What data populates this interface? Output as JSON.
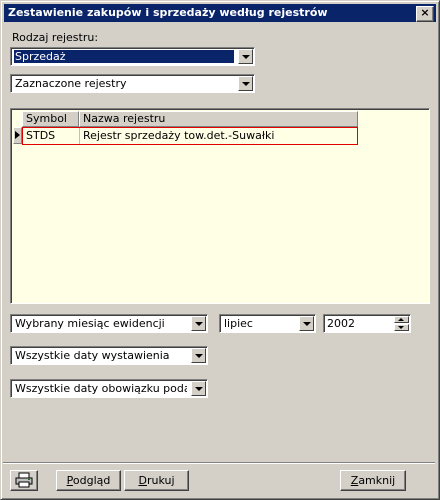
{
  "window": {
    "title": "Zestawienie zakupów i sprzedaży według rejestrów",
    "close_glyph": "×"
  },
  "register_type": {
    "label": "Rodzaj rejestru:",
    "value": "Sprzedaż"
  },
  "register_scope": {
    "value": "Zaznaczone rejestry"
  },
  "grid": {
    "columns": [
      "Symbol",
      "Nazwa rejestru"
    ],
    "rows": [
      {
        "symbol": "STDS",
        "name": "Rejestr sprzedaży tow.det.-Suwałki"
      }
    ]
  },
  "period": {
    "mode": "Wybrany miesiąc ewidencji",
    "month": "lipiec",
    "year": "2002"
  },
  "issue_dates": {
    "value": "Wszystkie daty wystawienia"
  },
  "tax_dates": {
    "value": "Wszystkie daty obowiązku podatkowego"
  },
  "buttons": {
    "preview": {
      "accel": "P",
      "rest": "odgląd"
    },
    "print": {
      "accel": "D",
      "rest": "rukuj"
    },
    "close": {
      "accel": "Z",
      "rest": "amknij"
    }
  },
  "icons": {
    "printer": "printer-icon"
  }
}
